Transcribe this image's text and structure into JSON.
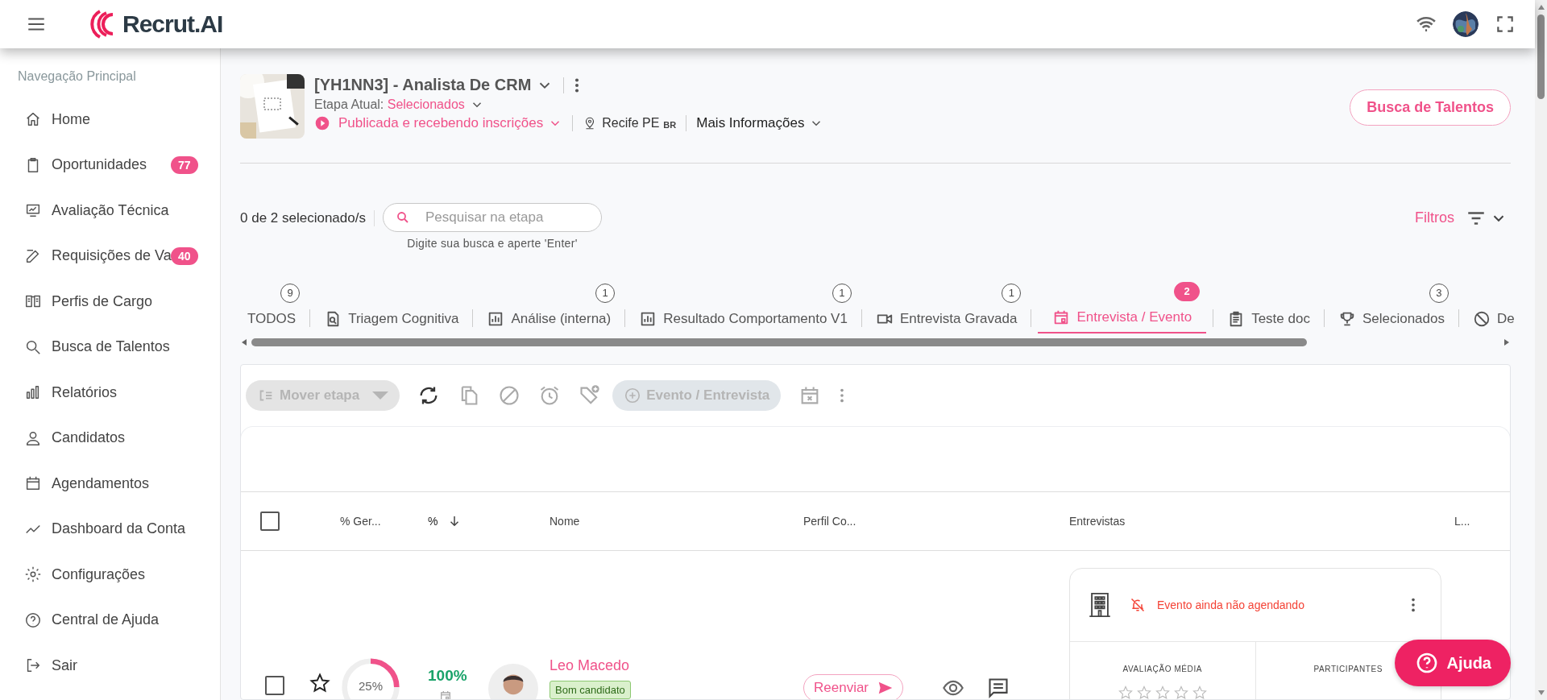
{
  "header": {
    "logo": "Recrut.AI"
  },
  "sidebar": {
    "heading": "Navegação Principal",
    "items": [
      {
        "label": "Home",
        "kind": "home",
        "selected": false
      },
      {
        "label": "Oportunidades",
        "kind": "clipboard",
        "badge": "77",
        "selected": false
      },
      {
        "label": "Avaliação Técnica",
        "kind": "board",
        "selected": false
      },
      {
        "label": "Requisições de Va",
        "kind": "edit",
        "badge": "40",
        "selected": false
      },
      {
        "label": "Perfis de Cargo",
        "kind": "book",
        "selected": false
      },
      {
        "label": "Busca de Talentos",
        "kind": "search",
        "selected": false
      },
      {
        "label": "Relatórios",
        "kind": "bars",
        "selected": false
      },
      {
        "label": "Candidatos",
        "kind": "person",
        "selected": false
      },
      {
        "label": "Agendamentos",
        "kind": "calendar",
        "selected": false
      },
      {
        "label": "Dashboard da Conta",
        "kind": "trend",
        "selected": false
      },
      {
        "label": "Configurações",
        "kind": "gear",
        "selected": false
      },
      {
        "label": "Central de Ajuda",
        "kind": "help",
        "selected": false
      },
      {
        "label": "Sair",
        "kind": "logout",
        "selected": false
      }
    ]
  },
  "job": {
    "title": "[YH1NN3] - Analista De CRM",
    "stage_label": "Etapa Atual:",
    "stage": "Selecionados",
    "status": "Publicada e recebendo inscrições",
    "location": "Recife PE",
    "country": "BR",
    "more_info": "Mais Informações",
    "talent_button": "Busca de Talentos"
  },
  "selection": {
    "count": "0 de 2 selecionado/s",
    "search": {
      "placeholder": "Pesquisar na etapa",
      "hint": "Digite sua busca e aperte 'Enter'"
    },
    "filters": "Filtros"
  },
  "tabs": [
    {
      "label": "TODOS",
      "kind": "all",
      "count": "9",
      "selected": false
    },
    {
      "label": "Triagem Cognitiva",
      "kind": "docsearch",
      "selected": false
    },
    {
      "label": "Análise (interna)",
      "kind": "chart",
      "count": "1",
      "selected": false
    },
    {
      "label": "Resultado Comportamento V1",
      "kind": "chart",
      "count": "1",
      "selected": false
    },
    {
      "label": "Entrevista Gravada",
      "kind": "video",
      "count": "1",
      "selected": false
    },
    {
      "label": "Entrevista / Evento",
      "kind": "calendar",
      "count": "2",
      "selected": true
    },
    {
      "label": "Teste doc",
      "kind": "list",
      "selected": false
    },
    {
      "label": "Selecionados",
      "kind": "trophy",
      "count": "3",
      "selected": false
    },
    {
      "label": "De",
      "kind": "block",
      "selected": false
    }
  ],
  "toolbar": {
    "move_button": {
      "label": "Mover etapa",
      "disabled": true
    },
    "event_button": {
      "label": "Evento / Entrevista",
      "disabled": true
    }
  },
  "table": {
    "select_all": {
      "checked": false
    },
    "columns": [
      {
        "label": "% Ger...",
        "sorted": false
      },
      {
        "label": "%",
        "sorted": true
      },
      {
        "label": "Nome",
        "sorted": false
      },
      {
        "label": "Perfil Co...",
        "sorted": false
      },
      {
        "label": "Entrevistas",
        "sorted": false
      },
      {
        "label": "L...",
        "sorted": false
      }
    ],
    "rows": [
      {
        "checked": false,
        "starred": false,
        "progress": {
          "level": 0.25,
          "label": "25%"
        },
        "score": "100%",
        "name": "Leo Macedo",
        "tag": "Bom candidato",
        "resend": "Reenviar",
        "interview": {
          "status": "Evento ainda não agendando",
          "rating_label": "AVALIAÇÃO MÉDIA",
          "stars": 0,
          "participants_label": "PARTICIPANTES"
        }
      }
    ]
  },
  "help_button": "Ajuda"
}
